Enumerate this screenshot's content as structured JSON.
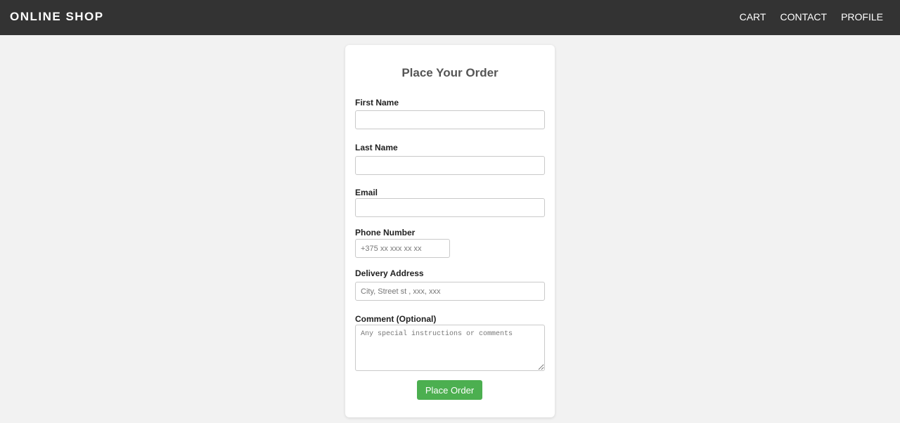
{
  "header": {
    "brand": "ONLINE SHOP",
    "nav": [
      {
        "label": "CART"
      },
      {
        "label": "CONTACT"
      },
      {
        "label": "PROFILE"
      }
    ]
  },
  "form": {
    "title": "Place Your Order",
    "first_name": {
      "label": "First Name",
      "value": "",
      "placeholder": ""
    },
    "last_name": {
      "label": "Last Name",
      "value": "",
      "placeholder": ""
    },
    "email": {
      "label": "Email",
      "value": "",
      "placeholder": ""
    },
    "phone": {
      "label": "Phone Number",
      "value": "",
      "placeholder": "+375 xx xxx xx xx"
    },
    "address": {
      "label": "Delivery Address",
      "value": "",
      "placeholder": "City, Street st , xxx, xxx"
    },
    "comment": {
      "label": "Comment (Optional)",
      "value": "",
      "placeholder": "Any special instructions or comments"
    },
    "submit_label": "Place Order"
  },
  "colors": {
    "navbar_bg": "#333333",
    "page_bg": "#f2f2f2",
    "submit_bg": "#4caf50"
  }
}
